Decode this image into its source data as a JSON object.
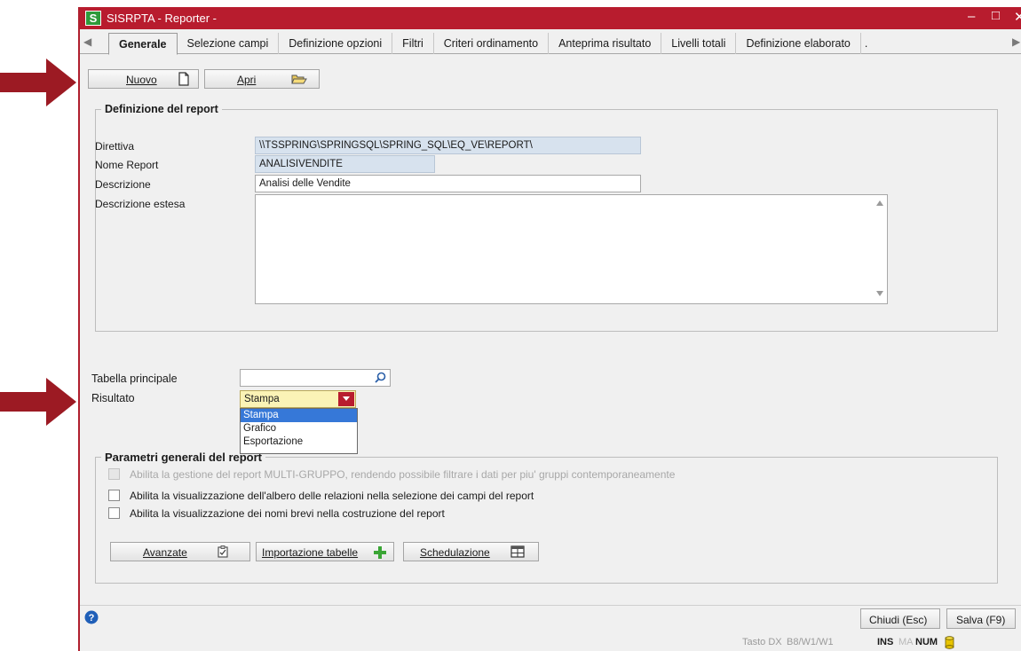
{
  "colors": {
    "titlebar": "#b81c2e",
    "arrow": "#9c1a23",
    "selection": "#3678d8",
    "readonly_field": "#d7e2ee"
  },
  "window": {
    "title": "SISRPTA - Reporter -",
    "app_icon": "S"
  },
  "tabs": [
    "Generale",
    "Selezione campi",
    "Definizione opzioni",
    "Filtri",
    "Criteri ordinamento",
    "Anteprima risultato",
    "Livelli totali",
    "Definizione elaborato",
    "."
  ],
  "toolbar": {
    "new_label": "Nuovo",
    "open_label": "Apri"
  },
  "report_def": {
    "legend": "Definizione del report",
    "directive_label": "Direttiva",
    "directive_value": "\\\\TSSPRING\\SPRINGSQL\\SPRING_SQL\\EQ_VE\\REPORT\\",
    "name_label": "Nome Report",
    "name_value": "ANALISIVENDITE",
    "desc_label": "Descrizione",
    "desc_value": "Analisi delle Vendite",
    "ext_desc_label": "Descrizione estesa",
    "ext_desc_value": ""
  },
  "main_table": {
    "label": "Tabella principale",
    "value": ""
  },
  "result": {
    "label": "Risultato",
    "selected": "Stampa",
    "options": [
      "Stampa",
      "Grafico",
      "Esportazione"
    ]
  },
  "params": {
    "legend": "Parametri generali del report",
    "checks": [
      {
        "label": "Abilita la gestione del report MULTI-GRUPPO, rendendo possibile filtrare i dati per piu' gruppi contemporaneamente",
        "checked": false,
        "disabled": true
      },
      {
        "label": "Abilita la visualizzazione dell'albero delle relazioni nella selezione dei campi del report",
        "checked": false,
        "disabled": false
      },
      {
        "label": "Abilita la visualizzazione dei nomi brevi nella costruzione del report",
        "checked": false,
        "disabled": false
      }
    ],
    "advanced_label": "Avanzate",
    "import_label": "Importazione tabelle",
    "schedule_label": "Schedulazione"
  },
  "footer": {
    "close_label": "Chiudi (Esc)",
    "save_label": "Salva (F9)"
  },
  "status": {
    "hint": "Tasto DX",
    "code": "B8/W1/W1",
    "ins": "INS",
    "ma": "MA",
    "num": "NUM"
  }
}
